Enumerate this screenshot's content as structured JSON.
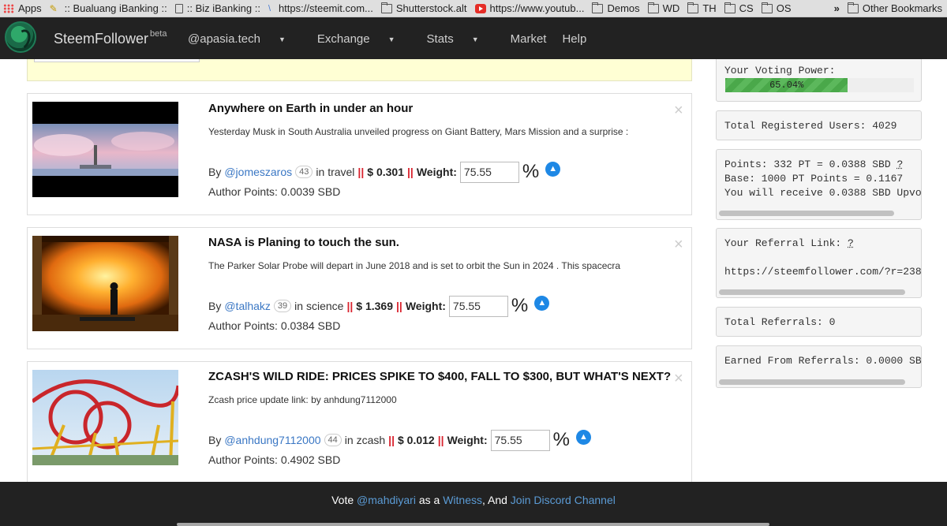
{
  "bookmarks": {
    "items": [
      {
        "label": "Apps",
        "icon": "apps-grid-icon"
      },
      {
        "label": ":: Bualuang iBanking ::",
        "icon": "pen-icon"
      },
      {
        "label": ":: Biz iBanking ::",
        "icon": "page-icon"
      },
      {
        "label": "https://steemit.com...",
        "icon": "link-icon"
      },
      {
        "label": "Shutterstock.alt",
        "icon": "folder-icon"
      },
      {
        "label": "https://www.youtub...",
        "icon": "youtube-icon"
      },
      {
        "label": "Demos",
        "icon": "folder-icon"
      },
      {
        "label": "WD",
        "icon": "folder-icon"
      },
      {
        "label": "TH",
        "icon": "folder-icon"
      },
      {
        "label": "CS",
        "icon": "folder-icon"
      },
      {
        "label": "OS",
        "icon": "folder-icon"
      }
    ],
    "more": "»",
    "other": "Other Bookmarks"
  },
  "nav": {
    "brand": "SteemFollower",
    "brand_tag": "beta",
    "links": [
      "@apasia.tech",
      "Exchange",
      "Stats",
      "Market",
      "Help"
    ]
  },
  "posts": [
    {
      "title": "Anywhere on Earth in under an hour",
      "description": "Yesterday Musk in South Australia unveiled progress on Giant Battery, Mars Mission and a surprise :",
      "by": "By",
      "author": "@jomeszaros",
      "reputation": "43",
      "category_prefix": "in",
      "category": "travel",
      "separator": "||",
      "payout": "$ 0.301",
      "weight_label": "Weight:",
      "weight": "75.55",
      "percent": "%",
      "author_points": "Author Points: 0.0039 SBD",
      "close": "×"
    },
    {
      "title": "NASA is Planing to touch the sun.",
      "description": "The Parker Solar Probe will depart in June 2018 and is set to orbit the Sun in 2024 . This spacecra",
      "by": "By",
      "author": "@talhakz",
      "reputation": "39",
      "category_prefix": "in",
      "category": "science",
      "separator": "||",
      "payout": "$ 1.369",
      "weight_label": "Weight:",
      "weight": "75.55",
      "percent": "%",
      "author_points": "Author Points: 0.0384 SBD",
      "close": "×"
    },
    {
      "title": "ZCASH'S WILD RIDE: PRICES SPIKE TO $400, FALL TO $300, BUT WHAT'S NEXT?",
      "description": "Zcash price update link: by anhdung7112000",
      "by": "By",
      "author": "@anhdung7112000",
      "reputation": "44",
      "category_prefix": "in",
      "category": "zcash",
      "separator": "||",
      "payout": "$ 0.012",
      "weight_label": "Weight:",
      "weight": "75.55",
      "percent": "%",
      "author_points": "Author Points: 0.4902 SBD",
      "close": "×"
    }
  ],
  "sidebar": {
    "voting_power_label": "Your Voting Power:",
    "voting_power_text": "65.04%",
    "voting_power_fraction": 0.6504,
    "registered_users": "Total Registered Users: 4029",
    "points_line1": "Points: 332 PT = 0.0388 SBD",
    "points_help": "?",
    "points_line2": "Base: 1000 PT Points = 0.1167",
    "points_line3": "You will receive 0.0388 SBD Upvo",
    "referral_label": "Your Referral Link:",
    "referral_help": "?",
    "referral_url": "https://steemfollower.com/?r=238",
    "total_referrals": "Total Referrals: 0",
    "earned_referrals": "Earned From Referrals: 0.0000 SB"
  },
  "footer": {
    "vote": "Vote",
    "witness_user": "@mahdiyari",
    "as_a": "as a",
    "witness": "Witness",
    "and": ", And",
    "discord": "Join Discord Channel"
  },
  "colors": {
    "navbar": "#222222",
    "link": "#3a77c4",
    "separator": "#d9232e",
    "vote_button": "#1e88e5",
    "voting_power": "#5cb85c"
  }
}
